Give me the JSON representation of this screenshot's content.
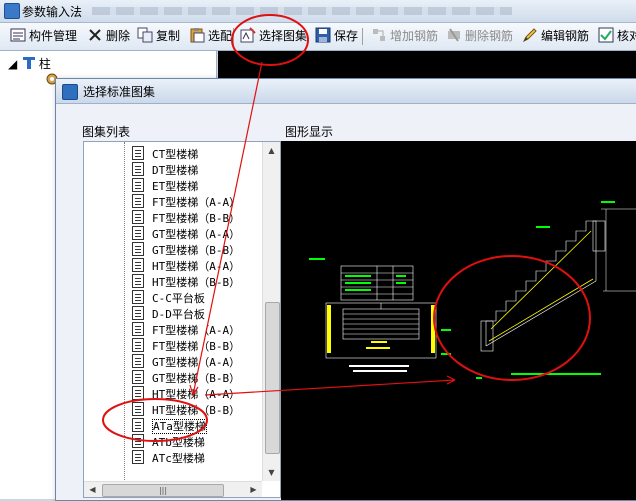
{
  "app": {
    "title": "参数输入法"
  },
  "toolbar": {
    "component_mgmt": "构件管理",
    "delete": "删除",
    "copy": "复制",
    "select_config": "选配",
    "select_atlas": "选择图集",
    "save": "保存",
    "add_rebar": "增加钢筋",
    "delete_rebar": "删除钢筋",
    "edit_rebar": "编辑钢筋",
    "check": "核对"
  },
  "tree": {
    "root": "柱"
  },
  "dialog": {
    "title": "选择标准图集",
    "list_label": "图集列表",
    "view_label": "图形显示",
    "items": [
      "CT型楼梯",
      "DT型楼梯",
      "ET型楼梯",
      "FT型楼梯（A-A）",
      "FT型楼梯（B-B）",
      "GT型楼梯（A-A）",
      "GT型楼梯（B-B）",
      "HT型楼梯（A-A）",
      "HT型楼梯（B-B）",
      "C-C平台板",
      "D-D平台板",
      "FT型楼梯（A-A）",
      "FT型楼梯（B-B）",
      "GT型楼梯（A-A）",
      "GT型楼梯（B-B）",
      "HT型楼梯（A-A）",
      "HT型楼梯（B-B）",
      "ATa型楼梯",
      "ATb型楼梯",
      "ATc型楼梯"
    ],
    "selected_index": 17
  },
  "colors": {
    "annotation": "#e01010",
    "cad_bg": "#000000",
    "cad_line": "#ffffff",
    "cad_green": "#00ff00",
    "cad_yellow": "#ffff00"
  }
}
